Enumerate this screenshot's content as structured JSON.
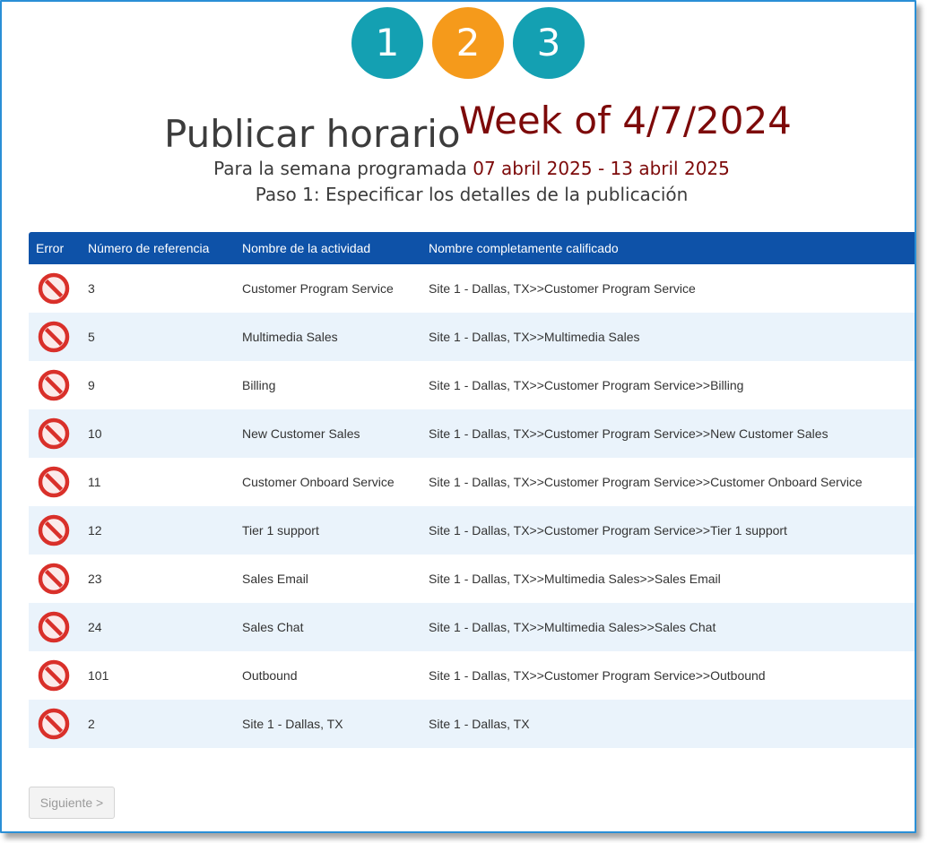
{
  "steps": [
    "1",
    "2",
    "3"
  ],
  "colors": {
    "step_inactive": "#14a0b2",
    "step_active": "#f59a1b",
    "header_bg": "#0e52a8",
    "date_text": "#7d0a0a",
    "error_icon": "#d9302a"
  },
  "header": {
    "title": "Publicar horario",
    "week": "Week of 4/7/2024",
    "subtitle_prefix": "Para la semana programada",
    "subtitle_dates": "07 abril 2025 - 13 abril 2025",
    "step_text": "Paso 1: Especificar los detalles de la publicación"
  },
  "table": {
    "columns": [
      "Error",
      "Número de referencia",
      "Nombre de la actividad",
      "Nombre completamente calificado"
    ],
    "rows": [
      {
        "icon": "error-prohibited-icon",
        "ref": "3",
        "name": "Customer Program Service",
        "full": "Site 1 - Dallas, TX>>Customer Program Service"
      },
      {
        "icon": "error-prohibited-icon",
        "ref": "5",
        "name": "Multimedia Sales",
        "full": "Site 1 - Dallas, TX>>Multimedia Sales"
      },
      {
        "icon": "error-prohibited-icon",
        "ref": "9",
        "name": "Billing",
        "full": "Site 1 - Dallas, TX>>Customer Program Service>>Billing"
      },
      {
        "icon": "error-prohibited-icon",
        "ref": "10",
        "name": "New Customer Sales",
        "full": "Site 1 - Dallas, TX>>Customer Program Service>>New Customer Sales"
      },
      {
        "icon": "error-prohibited-icon",
        "ref": "11",
        "name": "Customer Onboard Service",
        "full": "Site 1 - Dallas, TX>>Customer Program Service>>Customer Onboard Service"
      },
      {
        "icon": "error-prohibited-icon",
        "ref": "12",
        "name": "Tier 1 support",
        "full": "Site 1 - Dallas, TX>>Customer Program Service>>Tier 1 support"
      },
      {
        "icon": "error-prohibited-icon",
        "ref": "23",
        "name": "Sales Email",
        "full": "Site 1 - Dallas, TX>>Multimedia Sales>>Sales Email"
      },
      {
        "icon": "error-prohibited-icon",
        "ref": "24",
        "name": "Sales Chat",
        "full": "Site 1 - Dallas, TX>>Multimedia Sales>>Sales Chat"
      },
      {
        "icon": "error-prohibited-icon",
        "ref": "101",
        "name": "Outbound",
        "full": "Site 1 - Dallas, TX>>Customer Program Service>>Outbound"
      },
      {
        "icon": "error-prohibited-icon",
        "ref": "2",
        "name": "Site 1 - Dallas, TX",
        "full": "Site 1 - Dallas, TX"
      }
    ]
  },
  "footer": {
    "next_label": "Siguiente >"
  }
}
